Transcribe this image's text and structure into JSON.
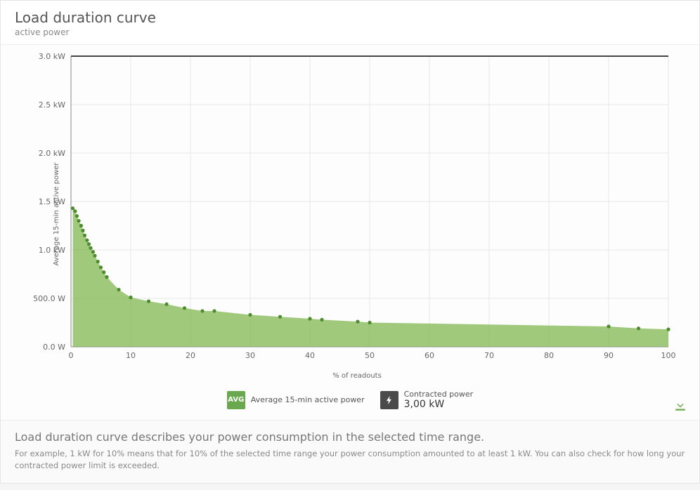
{
  "header": {
    "title": "Load duration curve",
    "subtitle": "active power"
  },
  "chart": {
    "ylabel": "Average 15-min active power",
    "xlabel": "% of readouts"
  },
  "legend": {
    "avg_badge": "AVG",
    "avg_label": "Average 15-min active power",
    "cp_label": "Contracted power",
    "cp_value": "3,00 kW"
  },
  "note": {
    "title": "Load duration curve describes your power consumption in the selected time range.",
    "body": "For example, 1 kW for 10% means that for 10% of the selected time range your power consumption amounted to at least 1 kW. You can also check for how long your contracted power limit is exceeded."
  },
  "chart_data": {
    "type": "area",
    "title": "Load duration curve",
    "xlabel": "% of readouts",
    "ylabel": "Average 15-min active power",
    "xlim": [
      0,
      100
    ],
    "ylim": [
      0,
      3.0
    ],
    "y_ticks": [
      "0.0 W",
      "500.0 W",
      "1.0 kW",
      "1.5 kW",
      "2.0 kW",
      "2.5 kW",
      "3.0 kW"
    ],
    "x_ticks": [
      0,
      10,
      20,
      30,
      40,
      50,
      60,
      70,
      80,
      90,
      100
    ],
    "series": [
      {
        "name": "Average 15-min active power",
        "x": [
          0.3,
          0.7,
          1.0,
          1.3,
          1.7,
          2.0,
          2.3,
          2.7,
          3.0,
          3.3,
          3.7,
          4.0,
          4.5,
          5.0,
          5.5,
          6.0,
          8.0,
          10.0,
          13.0,
          16.0,
          19.0,
          22.0,
          24.0,
          30.0,
          35.0,
          40.0,
          42.0,
          48.0,
          50.0,
          90.0,
          95.0,
          100.0
        ],
        "values": [
          1430,
          1400,
          1350,
          1300,
          1250,
          1200,
          1150,
          1100,
          1060,
          1020,
          980,
          940,
          880,
          820,
          770,
          720,
          590,
          510,
          470,
          440,
          400,
          370,
          370,
          330,
          310,
          290,
          280,
          260,
          250,
          210,
          190,
          180
        ]
      },
      {
        "name": "Contracted power",
        "constant": 3000
      }
    ],
    "legend": [
      "Average 15-min active power",
      "Contracted power 3,00 kW"
    ],
    "grid": true
  }
}
